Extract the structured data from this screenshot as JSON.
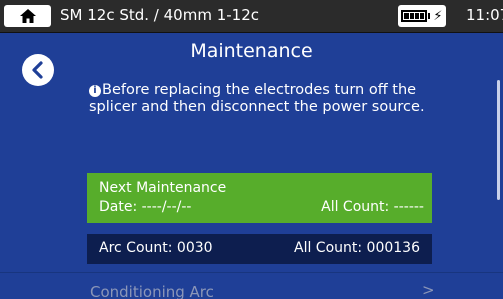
{
  "status_bar": {
    "title": "SM 12c Std. / 40mm 1-12c",
    "time": "11:07",
    "home_icon": "home-icon",
    "battery_icon": "battery-icon",
    "charging_icon": "lightning-bolt-icon"
  },
  "page": {
    "title": "Maintenance",
    "back_icon": "chevron-left-icon",
    "note": "Before replacing the electrodes turn off the splicer and then disconnect the power source."
  },
  "next_maintenance": {
    "title": "Next Maintenance",
    "date": "Date: ----/--/--",
    "all_count": "All Count: ------"
  },
  "arc_info": {
    "arc_count": "Arc Count: 0030",
    "all_count": "All Count: 000136"
  },
  "menu": {
    "items": [
      {
        "label": "Conditioning Arc",
        "arrow": ">"
      }
    ]
  },
  "colors": {
    "panel_bg": "#1f3f97",
    "status_bg": "#2b2b2b",
    "next_box_bg": "#57ad2b",
    "arc_box_bg": "#0d1e4f"
  }
}
